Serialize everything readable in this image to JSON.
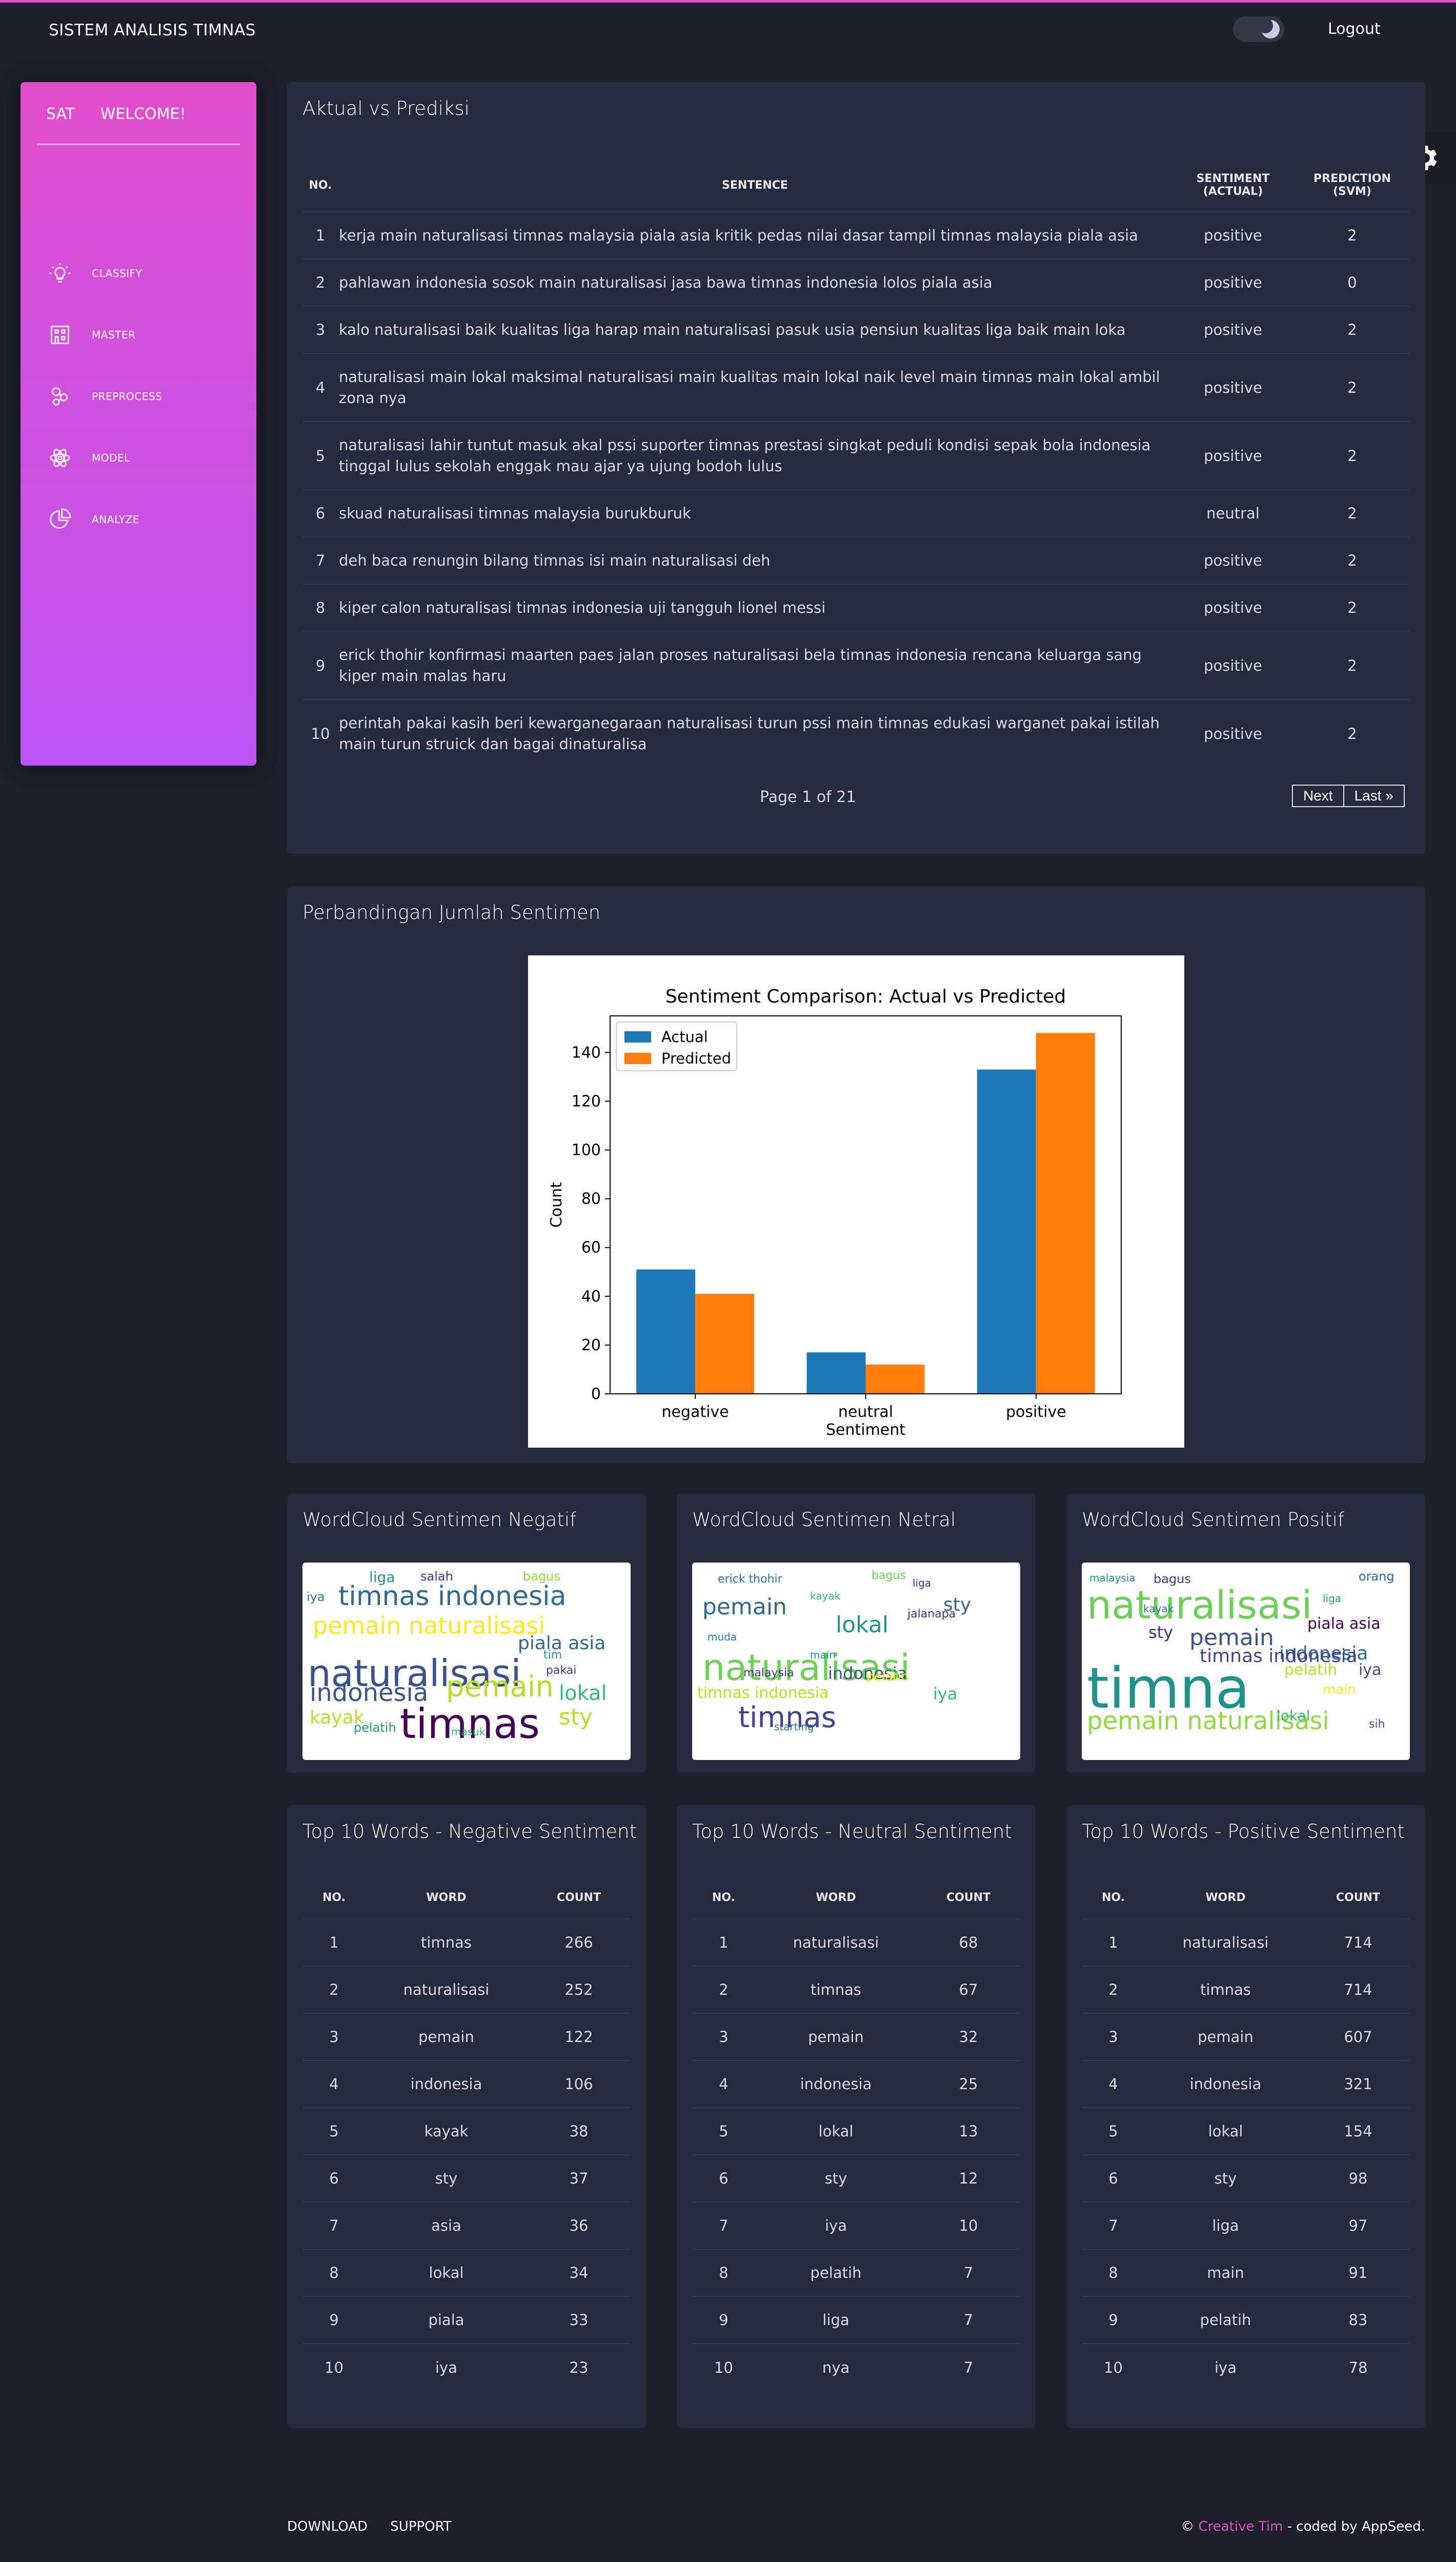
{
  "navbar": {
    "brand": "SISTEM ANALISIS TIMNAS",
    "logout": "Logout"
  },
  "sidebar": {
    "mini": "SAT",
    "title": "WELCOME!",
    "items": [
      {
        "label": "CLASSIFY",
        "icon": "bulb-icon"
      },
      {
        "label": "MASTER",
        "icon": "building-icon"
      },
      {
        "label": "PREPROCESS",
        "icon": "molecule-icon"
      },
      {
        "label": "MODEL",
        "icon": "atom-icon"
      },
      {
        "label": "ANALYZE",
        "icon": "pie-chart-icon"
      }
    ]
  },
  "prediction": {
    "title": "Aktual vs Prediksi",
    "headers": {
      "no": "NO.",
      "sentence": "SENTENCE",
      "actual": "SENTIMENT (ACTUAL)",
      "pred": "PREDICTION (SVM)"
    },
    "rows": [
      {
        "no": "1",
        "sentence": "kerja main naturalisasi timnas malaysia piala asia kritik pedas nilai dasar tampil timnas malaysia piala asia",
        "actual": "positive",
        "pred": "2"
      },
      {
        "no": "2",
        "sentence": "pahlawan indonesia sosok main naturalisasi jasa bawa timnas indonesia lolos piala asia",
        "actual": "positive",
        "pred": "0"
      },
      {
        "no": "3",
        "sentence": "kalo naturalisasi baik kualitas liga harap main naturalisasi pasuk usia pensiun kualitas liga baik main loka",
        "actual": "positive",
        "pred": "2"
      },
      {
        "no": "4",
        "sentence": "naturalisasi main lokal maksimal naturalisasi main kualitas main lokal naik level main timnas main lokal ambil zona nya",
        "actual": "positive",
        "pred": "2"
      },
      {
        "no": "5",
        "sentence": "naturalisasi lahir tuntut masuk akal pssi suporter timnas prestasi singkat peduli kondisi sepak bola indonesia tinggal lulus sekolah enggak mau ajar ya ujung bodoh lulus",
        "actual": "positive",
        "pred": "2"
      },
      {
        "no": "6",
        "sentence": "skuad naturalisasi timnas malaysia burukburuk",
        "actual": "neutral",
        "pred": "2"
      },
      {
        "no": "7",
        "sentence": "deh baca renungin bilang timnas isi main naturalisasi deh",
        "actual": "positive",
        "pred": "2"
      },
      {
        "no": "8",
        "sentence": "kiper calon naturalisasi timnas indonesia uji tangguh lionel messi",
        "actual": "positive",
        "pred": "2"
      },
      {
        "no": "9",
        "sentence": "erick thohir konfirmasi maarten paes jalan proses naturalisasi bela timnas indonesia rencana keluarga sang kiper main malas haru",
        "actual": "positive",
        "pred": "2"
      },
      {
        "no": "10",
        "sentence": "perintah pakai kasih beri kewarganegaraan naturalisasi turun pssi main timnas edukasi warganet pakai istilah main turun struick dan bagai dinaturalisa",
        "actual": "positive",
        "pred": "2"
      }
    ],
    "page_text": "Page 1 of 21",
    "next": "Next",
    "last": "Last »"
  },
  "comparison": {
    "title": "Perbandingan Jumlah Sentimen"
  },
  "chart_data": {
    "type": "bar",
    "title": "Sentiment Comparison: Actual vs Predicted",
    "xlabel": "Sentiment",
    "ylabel": "Count",
    "categories": [
      "negative",
      "neutral",
      "positive"
    ],
    "series": [
      {
        "name": "Actual",
        "values": [
          51,
          17,
          133
        ],
        "color": "#1f77b4"
      },
      {
        "name": "Predicted",
        "values": [
          41,
          12,
          148
        ],
        "color": "#ff7f0e"
      }
    ],
    "ylim": [
      0,
      155
    ],
    "yticks": [
      0,
      20,
      40,
      60,
      80,
      100,
      120,
      140
    ],
    "legend": "top-left",
    "grid": false
  },
  "wordclouds": [
    {
      "title": "WordCloud Sentimen Negatif",
      "words": [
        {
          "t": "naturalisasi",
          "c": "#3b528b"
        },
        {
          "t": "timnas",
          "c": "#440154"
        },
        {
          "t": "timnas indonesia",
          "c": "#31688e"
        },
        {
          "t": "pemain naturalisasi",
          "c": "#fde725"
        },
        {
          "t": "indonesia",
          "c": "#3b528b"
        },
        {
          "t": "pemain",
          "c": "#b5de2b"
        },
        {
          "t": "piala asia",
          "c": "#31688e"
        },
        {
          "t": "lokal",
          "c": "#35b779"
        },
        {
          "t": "kayak",
          "c": "#b5de2b"
        },
        {
          "t": "sty",
          "c": "#b5de2b"
        },
        {
          "t": "liga",
          "c": "#21918c"
        },
        {
          "t": "salah",
          "c": "#443983"
        },
        {
          "t": "pelatih",
          "c": "#21918c"
        },
        {
          "t": "iya",
          "c": "#2c728e"
        },
        {
          "t": "bagus",
          "c": "#90d743"
        },
        {
          "t": "pakai",
          "c": "#443983"
        },
        {
          "t": "tim",
          "c": "#21918c"
        },
        {
          "t": "masuk",
          "c": "#35b779"
        }
      ]
    },
    {
      "title": "WordCloud Sentimen Netral",
      "words": [
        {
          "t": "naturalisasi",
          "c": "#6ece58"
        },
        {
          "t": "timnas",
          "c": "#414487"
        },
        {
          "t": "pemain",
          "c": "#31688e"
        },
        {
          "t": "lokal",
          "c": "#21918c"
        },
        {
          "t": "indonesia",
          "c": "#3b528b"
        },
        {
          "t": "timnas indonesia",
          "c": "#b5de2b"
        },
        {
          "t": "sty",
          "c": "#31688e"
        },
        {
          "t": "iya",
          "c": "#35b779"
        },
        {
          "t": "liga",
          "c": "#482878"
        },
        {
          "t": "erick thohir",
          "c": "#2c728e"
        },
        {
          "t": "pelatih",
          "c": "#fde725"
        },
        {
          "t": "main",
          "c": "#1f9e89"
        },
        {
          "t": "jalanapa",
          "c": "#482878"
        },
        {
          "t": "bagus",
          "c": "#6ece58"
        },
        {
          "t": "malaysia",
          "c": "#443983"
        },
        {
          "t": "starting",
          "c": "#31688e"
        },
        {
          "t": "kayak",
          "c": "#35b779"
        },
        {
          "t": "muda",
          "c": "#26828e"
        }
      ]
    },
    {
      "title": "WordCloud Sentimen Positif",
      "words": [
        {
          "t": "naturalisasi",
          "c": "#6ece58"
        },
        {
          "t": "timna",
          "c": "#21918c"
        },
        {
          "t": "pemain",
          "c": "#3b528b"
        },
        {
          "t": "pemain naturalisasi",
          "c": "#90d743"
        },
        {
          "t": "indonesia",
          "c": "#31688e"
        },
        {
          "t": "timnas indonesia",
          "c": "#414487"
        },
        {
          "t": "piala asia",
          "c": "#440154"
        },
        {
          "t": "sty",
          "c": "#482878"
        },
        {
          "t": "pelatih",
          "c": "#b5de2b"
        },
        {
          "t": "iya",
          "c": "#3e4989"
        },
        {
          "t": "lokal",
          "c": "#35b779"
        },
        {
          "t": "bagus",
          "c": "#443983"
        },
        {
          "t": "malaysia",
          "c": "#21918c"
        },
        {
          "t": "main",
          "c": "#fde725"
        },
        {
          "t": "orang",
          "c": "#31688e"
        },
        {
          "t": "liga",
          "c": "#1f9e89"
        },
        {
          "t": "kayak",
          "c": "#2c728e"
        },
        {
          "t": "sih",
          "c": "#3b528b"
        }
      ]
    }
  ],
  "top_words": [
    {
      "title": "Top 10 Words - Negative Sentiment",
      "headers": {
        "no": "NO.",
        "word": "WORD",
        "count": "COUNT"
      },
      "rows": [
        {
          "no": "1",
          "word": "timnas",
          "count": "266"
        },
        {
          "no": "2",
          "word": "naturalisasi",
          "count": "252"
        },
        {
          "no": "3",
          "word": "pemain",
          "count": "122"
        },
        {
          "no": "4",
          "word": "indonesia",
          "count": "106"
        },
        {
          "no": "5",
          "word": "kayak",
          "count": "38"
        },
        {
          "no": "6",
          "word": "sty",
          "count": "37"
        },
        {
          "no": "7",
          "word": "asia",
          "count": "36"
        },
        {
          "no": "8",
          "word": "lokal",
          "count": "34"
        },
        {
          "no": "9",
          "word": "piala",
          "count": "33"
        },
        {
          "no": "10",
          "word": "iya",
          "count": "23"
        }
      ]
    },
    {
      "title": "Top 10 Words - Neutral Sentiment",
      "headers": {
        "no": "NO.",
        "word": "WORD",
        "count": "COUNT"
      },
      "rows": [
        {
          "no": "1",
          "word": "naturalisasi",
          "count": "68"
        },
        {
          "no": "2",
          "word": "timnas",
          "count": "67"
        },
        {
          "no": "3",
          "word": "pemain",
          "count": "32"
        },
        {
          "no": "4",
          "word": "indonesia",
          "count": "25"
        },
        {
          "no": "5",
          "word": "lokal",
          "count": "13"
        },
        {
          "no": "6",
          "word": "sty",
          "count": "12"
        },
        {
          "no": "7",
          "word": "iya",
          "count": "10"
        },
        {
          "no": "8",
          "word": "pelatih",
          "count": "7"
        },
        {
          "no": "9",
          "word": "liga",
          "count": "7"
        },
        {
          "no": "10",
          "word": "nya",
          "count": "7"
        }
      ]
    },
    {
      "title": "Top 10 Words - Positive Sentiment",
      "headers": {
        "no": "NO.",
        "word": "WORD",
        "count": "COUNT"
      },
      "rows": [
        {
          "no": "1",
          "word": "naturalisasi",
          "count": "714"
        },
        {
          "no": "2",
          "word": "timnas",
          "count": "714"
        },
        {
          "no": "3",
          "word": "pemain",
          "count": "607"
        },
        {
          "no": "4",
          "word": "indonesia",
          "count": "321"
        },
        {
          "no": "5",
          "word": "lokal",
          "count": "154"
        },
        {
          "no": "6",
          "word": "sty",
          "count": "98"
        },
        {
          "no": "7",
          "word": "liga",
          "count": "97"
        },
        {
          "no": "8",
          "word": "main",
          "count": "91"
        },
        {
          "no": "9",
          "word": "pelatih",
          "count": "83"
        },
        {
          "no": "10",
          "word": "iya",
          "count": "78"
        }
      ]
    }
  ],
  "footer": {
    "download": "DOWNLOAD",
    "support": "SUPPORT",
    "copyright_prefix": "©",
    "creative_tim": "Creative Tim",
    "coded_by": "- coded by AppSeed."
  },
  "colors": {
    "accent": "#e14eca",
    "accent2": "#ba54f5",
    "background": "#1f1f2b",
    "card": "#27293d"
  }
}
